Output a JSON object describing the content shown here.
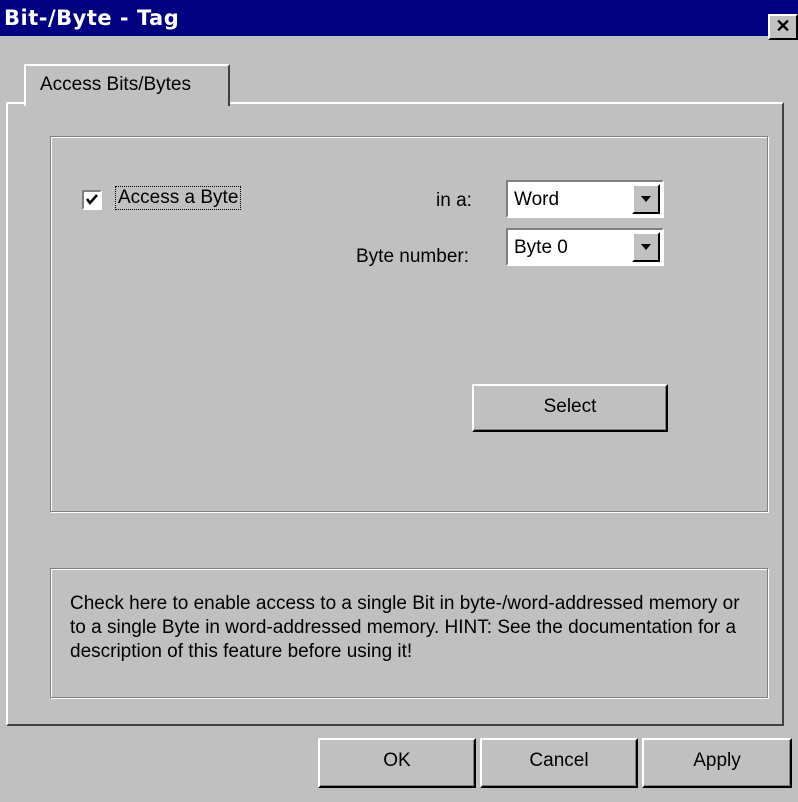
{
  "window": {
    "title": "Bit-/Byte - Tag",
    "close_label": "✕"
  },
  "tabs": [
    {
      "label": "Access Bits/Bytes"
    }
  ],
  "access": {
    "checkbox_label": "Access a Byte",
    "checked": true,
    "in_a_label": "in a:",
    "in_a_value": "Word",
    "byte_number_label": "Byte number:",
    "byte_number_value": "Byte 0",
    "select_button": "Select"
  },
  "hint": "Check here to enable access to a single Bit in byte-/word-addressed memory or to a single Byte in word-addressed memory. HINT: See the documentation for a description of this feature before using it!",
  "buttons": {
    "ok": "OK",
    "cancel": "Cancel",
    "apply": "Apply"
  },
  "icons": {
    "close": "close-icon",
    "dropdown": "chevron-down-icon",
    "check": "check-icon"
  },
  "colors": {
    "titlebar": "#000080",
    "face": "#c0c0c0"
  }
}
